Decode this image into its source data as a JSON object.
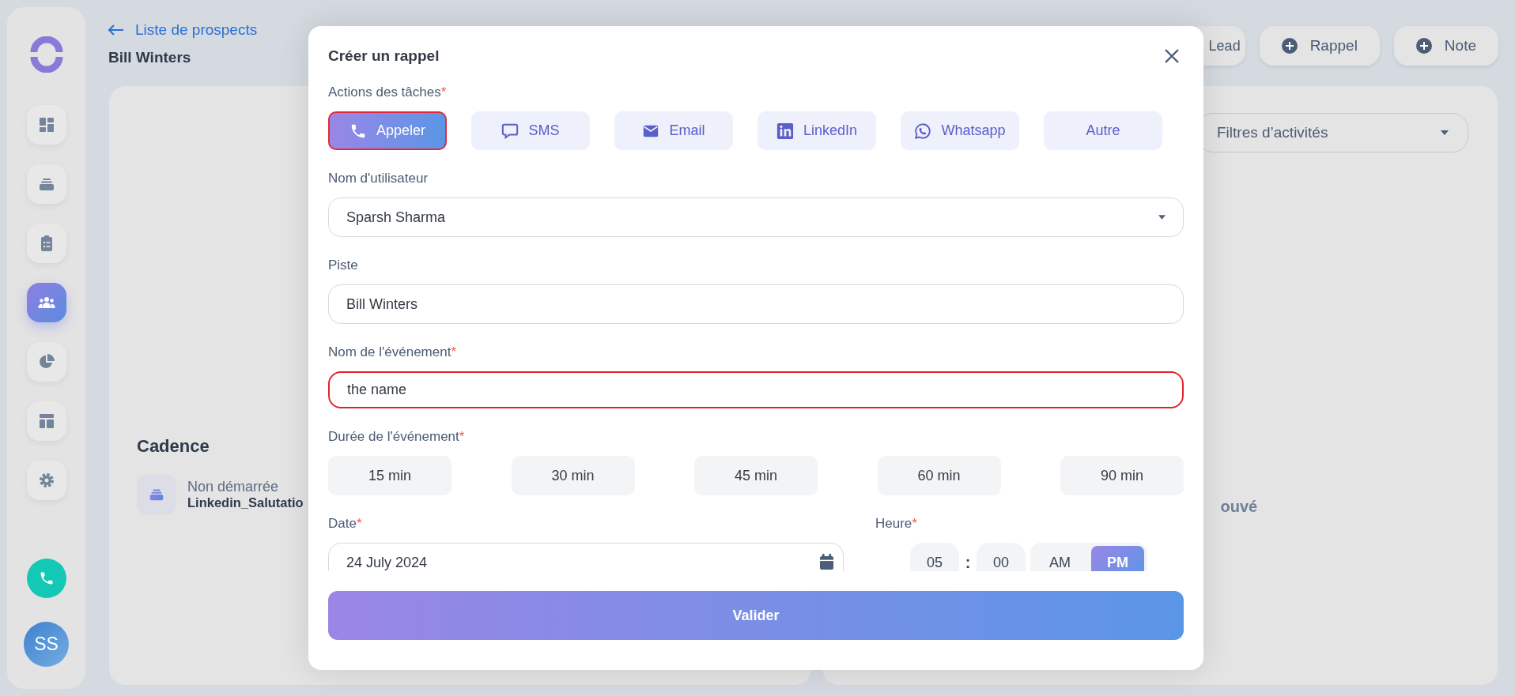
{
  "sidebar": {
    "items": [
      {
        "kind": "dashboard",
        "selected": false
      },
      {
        "kind": "stack",
        "selected": false
      },
      {
        "kind": "clipboard",
        "selected": false
      },
      {
        "kind": "people",
        "selected": true
      },
      {
        "kind": "pie",
        "selected": false
      },
      {
        "kind": "layout",
        "selected": false
      },
      {
        "kind": "settings",
        "selected": false
      }
    ],
    "avatar": "SS"
  },
  "header": {
    "back_link": "Liste de prospects",
    "title": "Bill Winters",
    "actions": [
      "Lead",
      "Rappel",
      "Note"
    ]
  },
  "lead_card": {
    "cadence_title": "Cadence",
    "cadence_status": "Non démarrée",
    "cadence_name": "Linkedin_Salutatio"
  },
  "activity_card": {
    "filter": "Filtres d’activités",
    "empty_text": "ouvé"
  },
  "modal": {
    "title": "Créer un rappel",
    "actions_field": {
      "label": "Actions des tâches",
      "required_mark": "*"
    },
    "actions": [
      {
        "kind": "call",
        "label": "Appeler",
        "selected": true
      },
      {
        "kind": "sms",
        "label": "SMS",
        "selected": false
      },
      {
        "kind": "email",
        "label": "Email",
        "selected": false
      },
      {
        "kind": "linkedin",
        "label": "LinkedIn",
        "selected": false
      },
      {
        "kind": "whatsapp",
        "label": "Whatsapp",
        "selected": false
      },
      {
        "kind": "other",
        "label": "Autre",
        "selected": false
      }
    ],
    "user_field": {
      "label": "Nom d'utilisateur",
      "value": "Sparsh Sharma"
    },
    "lead_field": {
      "label": "Piste",
      "value": "Bill Winters"
    },
    "event_name_field": {
      "label": "Nom de l'événement",
      "required_mark": "*",
      "value": "the name",
      "invalid": true
    },
    "duration_field": {
      "label": "Durée de l'événement",
      "required_mark": "*"
    },
    "durations": [
      {
        "label": "15 min",
        "selected": false
      },
      {
        "label": "30 min",
        "selected": false
      },
      {
        "label": "45 min",
        "selected": false
      },
      {
        "label": "60 min",
        "selected": false
      },
      {
        "label": "90 min",
        "selected": false
      }
    ],
    "date_field": {
      "label": "Date",
      "required_mark": "*",
      "value": "24 July 2024"
    },
    "time_field": {
      "label": "Heure",
      "required_mark": "*",
      "hour": "05",
      "separator": ":",
      "minute": "00"
    },
    "periods": [
      {
        "label": "AM",
        "selected": false
      },
      {
        "label": "PM",
        "selected": true
      }
    ],
    "submit": "Valider"
  }
}
